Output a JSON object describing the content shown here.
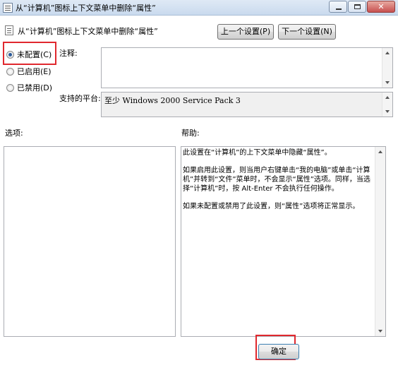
{
  "window": {
    "title": "从“计算机”图标上下文菜单中删除“属性”",
    "close_glyph": "✕"
  },
  "header": {
    "title": "从“计算机”图标上下文菜单中删除“属性”"
  },
  "nav": {
    "prev_label": "上一个设置(P)",
    "next_label": "下一个设置(N)"
  },
  "state": {
    "options": [
      {
        "label": "未配置(C)",
        "checked": true
      },
      {
        "label": "已启用(E)",
        "checked": false
      },
      {
        "label": "已禁用(D)",
        "checked": false
      }
    ]
  },
  "comment": {
    "label": "注释:",
    "value": ""
  },
  "platform": {
    "label": "支持的平台:",
    "value": "至少 Windows 2000 Service Pack 3"
  },
  "options_section": {
    "label": "选项:"
  },
  "help_section": {
    "label": "帮助:",
    "paragraphs": [
      "此设置在“计算机”的上下文菜单中隐藏“属性”。",
      "如果启用此设置，则当用户右键单击“我的电脑”或单击“计算机”并转到“文件”菜单时，不会显示“属性”选项。同样，当选择“计算机”时，按 Alt-Enter 不会执行任何操作。",
      "如果未配置或禁用了此设置，则“属性”选项将正常显示。"
    ]
  },
  "footer": {
    "ok_label": "确定"
  }
}
